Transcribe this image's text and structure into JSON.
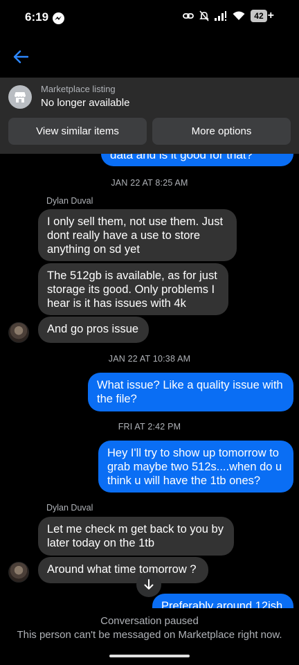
{
  "status_bar": {
    "time": "6:19",
    "battery": "42",
    "battery_suffix": "+"
  },
  "listing": {
    "label": "Marketplace listing",
    "status": "No longer available",
    "buttons": [
      "View similar items",
      "More options"
    ]
  },
  "messages": {
    "partial_top": "data and is it good for that?",
    "ts1": "JAN 22 AT 8:25 AM",
    "sender1": "Dylan Duval",
    "m1": "I only sell them, not use them.  Just dont really have a use to store anything on sd yet",
    "m2": "The 512gb is available, as for just storage its good.  Only problems I hear is it has issues with 4k",
    "m3": "And go pros issue",
    "ts2": "JAN 22 AT 10:38 AM",
    "m4": "What issue? Like a quality issue with the file?",
    "ts3": "FRI AT 2:42 PM",
    "m5": "Hey I'll try to show up tomorrow to grab maybe two 512s....when do u think u will have the 1tb ones?",
    "sender2": "Dylan Duval",
    "m6": "Let me check m get back to you by later today on the 1tb",
    "m7": "Around what time tomorrow ?",
    "partial_bottom": "Preferably around 12ish"
  },
  "footer": {
    "title": "Conversation paused",
    "description": "This person can't be messaged on Marketplace right now."
  },
  "colors": {
    "accent": "#0a6ef4",
    "incoming_bubble": "#333333",
    "card_bg": "#2b2b2b"
  }
}
